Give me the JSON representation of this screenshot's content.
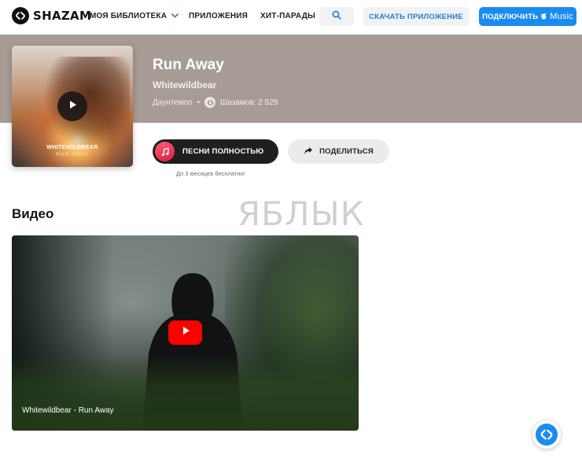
{
  "header": {
    "logo_text": "SHAZAM",
    "nav": {
      "library": "МОЯ БИБЛИОТЕКА",
      "apps": "ПРИЛОЖЕНИЯ",
      "charts": "ХИТ-ПАРАДЫ"
    },
    "download_label": "СКАЧАТЬ ПРИЛОЖЕНИЕ",
    "connect_label": "ПОДКЛЮЧИТЬ",
    "connect_service": "Music"
  },
  "track": {
    "title": "Run Away",
    "artist": "Whitewildbear",
    "genre": "Даунтемпо",
    "separator": "•",
    "shazam_count": "Шазамов: 2 529",
    "cover_text_line1": "WHITEWILDBEAR",
    "cover_text_line2": "RUN AWAY"
  },
  "actions": {
    "full_songs_label": "ПЕСНИ ПОЛНОСТЬЮ",
    "share_label": "ПОДЕЛИТЬСЯ",
    "free_note": "До 3 месяцев бесплатно!"
  },
  "video_section": {
    "heading": "Видео",
    "caption": "Whitewildbear - Run Away"
  },
  "watermark": "ЯБЛЫК",
  "colors": {
    "hero_bg": "#a79c95",
    "accent_blue": "#1a8cf0",
    "youtube_red": "#ff0000"
  }
}
